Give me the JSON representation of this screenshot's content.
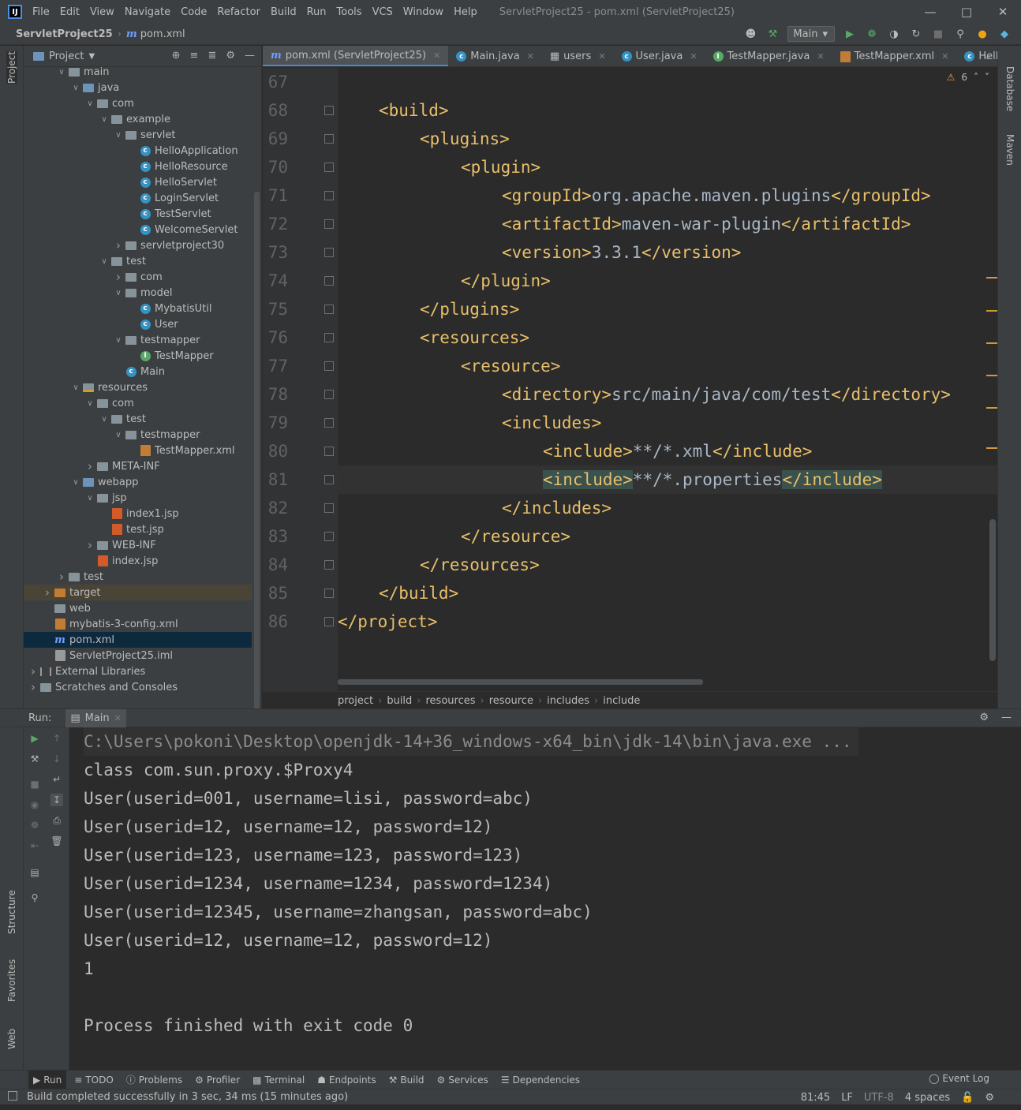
{
  "window": {
    "title": "ServletProject25 - pom.xml (ServletProject25)",
    "menu": [
      "File",
      "Edit",
      "View",
      "Navigate",
      "Code",
      "Refactor",
      "Build",
      "Run",
      "Tools",
      "VCS",
      "Window",
      "Help"
    ]
  },
  "navbar": {
    "project": "ServletProject25",
    "file": "pom.xml",
    "run_config": "Main"
  },
  "project_panel": {
    "title": "Project",
    "tree": [
      {
        "depth": 2,
        "arrow": "down",
        "icon": "folder",
        "label": "main"
      },
      {
        "depth": 3,
        "arrow": "down",
        "icon": "folder-blue",
        "label": "java"
      },
      {
        "depth": 4,
        "arrow": "down",
        "icon": "folder",
        "label": "com"
      },
      {
        "depth": 5,
        "arrow": "down",
        "icon": "folder",
        "label": "example"
      },
      {
        "depth": 6,
        "arrow": "down",
        "icon": "folder",
        "label": "servlet"
      },
      {
        "depth": 7,
        "arrow": "",
        "icon": "class",
        "label": "HelloApplication"
      },
      {
        "depth": 7,
        "arrow": "",
        "icon": "class",
        "label": "HelloResource"
      },
      {
        "depth": 7,
        "arrow": "",
        "icon": "class",
        "label": "HelloServlet"
      },
      {
        "depth": 7,
        "arrow": "",
        "icon": "class",
        "label": "LoginServlet"
      },
      {
        "depth": 7,
        "arrow": "",
        "icon": "class",
        "label": "TestServlet"
      },
      {
        "depth": 7,
        "arrow": "",
        "icon": "class",
        "label": "WelcomeServlet"
      },
      {
        "depth": 6,
        "arrow": "right",
        "icon": "folder",
        "label": "servletproject30"
      },
      {
        "depth": 5,
        "arrow": "down",
        "icon": "folder",
        "label": "test"
      },
      {
        "depth": 6,
        "arrow": "right",
        "icon": "folder",
        "label": "com"
      },
      {
        "depth": 6,
        "arrow": "down",
        "icon": "folder",
        "label": "model"
      },
      {
        "depth": 7,
        "arrow": "",
        "icon": "class",
        "label": "MybatisUtil"
      },
      {
        "depth": 7,
        "arrow": "",
        "icon": "class",
        "label": "User"
      },
      {
        "depth": 6,
        "arrow": "down",
        "icon": "folder",
        "label": "testmapper"
      },
      {
        "depth": 7,
        "arrow": "",
        "icon": "interface",
        "label": "TestMapper"
      },
      {
        "depth": 6,
        "arrow": "",
        "icon": "class",
        "label": "Main"
      },
      {
        "depth": 3,
        "arrow": "down",
        "icon": "folder-res",
        "label": "resources"
      },
      {
        "depth": 4,
        "arrow": "down",
        "icon": "folder",
        "label": "com"
      },
      {
        "depth": 5,
        "arrow": "down",
        "icon": "folder",
        "label": "test"
      },
      {
        "depth": 6,
        "arrow": "down",
        "icon": "folder",
        "label": "testmapper"
      },
      {
        "depth": 7,
        "arrow": "",
        "icon": "xml",
        "label": "TestMapper.xml"
      },
      {
        "depth": 4,
        "arrow": "right",
        "icon": "folder",
        "label": "META-INF"
      },
      {
        "depth": 3,
        "arrow": "down",
        "icon": "folder-blue",
        "label": "webapp"
      },
      {
        "depth": 4,
        "arrow": "down",
        "icon": "folder",
        "label": "jsp"
      },
      {
        "depth": 5,
        "arrow": "",
        "icon": "jsp",
        "label": "index1.jsp"
      },
      {
        "depth": 5,
        "arrow": "",
        "icon": "jsp",
        "label": "test.jsp"
      },
      {
        "depth": 4,
        "arrow": "right",
        "icon": "folder",
        "label": "WEB-INF"
      },
      {
        "depth": 4,
        "arrow": "",
        "icon": "jsp",
        "label": "index.jsp"
      },
      {
        "depth": 2,
        "arrow": "right",
        "icon": "folder",
        "label": "test"
      },
      {
        "depth": 1,
        "arrow": "right",
        "icon": "folder-orange",
        "label": "target",
        "state": "highlight"
      },
      {
        "depth": 1,
        "arrow": "",
        "icon": "folder",
        "label": "web"
      },
      {
        "depth": 1,
        "arrow": "",
        "icon": "xml",
        "label": "mybatis-3-config.xml"
      },
      {
        "depth": 1,
        "arrow": "",
        "icon": "maven",
        "label": "pom.xml",
        "state": "selected"
      },
      {
        "depth": 1,
        "arrow": "",
        "icon": "file",
        "label": "ServletProject25.iml"
      },
      {
        "depth": 0,
        "arrow": "right",
        "icon": "library",
        "label": "External Libraries"
      },
      {
        "depth": 0,
        "arrow": "right",
        "icon": "scratch",
        "label": "Scratches and Consoles"
      }
    ]
  },
  "editor": {
    "tabs": [
      {
        "label": "pom.xml (ServletProject25)",
        "icon": "maven",
        "active": true
      },
      {
        "label": "Main.java",
        "icon": "class"
      },
      {
        "label": "users",
        "icon": "table"
      },
      {
        "label": "User.java",
        "icon": "class"
      },
      {
        "label": "TestMapper.java",
        "icon": "interface"
      },
      {
        "label": "TestMapper.xml",
        "icon": "xml"
      },
      {
        "label": "HelloServlet.ja",
        "icon": "class"
      }
    ],
    "warning_count": "6",
    "lines": [
      {
        "n": "67",
        "indent": 0,
        "parts": []
      },
      {
        "n": "68",
        "indent": 1,
        "parts": [
          [
            "tag",
            "<build>"
          ]
        ]
      },
      {
        "n": "69",
        "indent": 2,
        "parts": [
          [
            "tag",
            "<plugins>"
          ]
        ]
      },
      {
        "n": "70",
        "indent": 3,
        "parts": [
          [
            "tag",
            "<plugin>"
          ]
        ]
      },
      {
        "n": "71",
        "indent": 4,
        "parts": [
          [
            "tag",
            "<groupId>"
          ],
          [
            "txt",
            "org.apache.maven.plugins"
          ],
          [
            "tag",
            "</groupId>"
          ]
        ]
      },
      {
        "n": "72",
        "indent": 4,
        "parts": [
          [
            "tag",
            "<artifactId>"
          ],
          [
            "txt",
            "maven-war-plugin"
          ],
          [
            "tag",
            "</artifactId>"
          ]
        ]
      },
      {
        "n": "73",
        "indent": 4,
        "parts": [
          [
            "tag",
            "<version>"
          ],
          [
            "txt",
            "3.3.1"
          ],
          [
            "tag",
            "</version>"
          ]
        ]
      },
      {
        "n": "74",
        "indent": 3,
        "parts": [
          [
            "tag",
            "</plugin>"
          ]
        ]
      },
      {
        "n": "75",
        "indent": 2,
        "parts": [
          [
            "tag",
            "</plugins>"
          ]
        ]
      },
      {
        "n": "76",
        "indent": 2,
        "parts": [
          [
            "tag",
            "<resources>"
          ]
        ]
      },
      {
        "n": "77",
        "indent": 3,
        "parts": [
          [
            "tag",
            "<resource>"
          ]
        ]
      },
      {
        "n": "78",
        "indent": 4,
        "parts": [
          [
            "tag",
            "<directory>"
          ],
          [
            "txt",
            "src/main/java/com/test"
          ],
          [
            "tag",
            "</directory>"
          ]
        ]
      },
      {
        "n": "79",
        "indent": 4,
        "parts": [
          [
            "tag",
            "<includes>"
          ]
        ]
      },
      {
        "n": "80",
        "indent": 5,
        "parts": [
          [
            "tag",
            "<include>"
          ],
          [
            "txt",
            "**/*.xml"
          ],
          [
            "tag",
            "</include>"
          ]
        ]
      },
      {
        "n": "81",
        "indent": 5,
        "parts": [
          [
            "tagm",
            "<include>"
          ],
          [
            "txt",
            "**/*.properties"
          ],
          [
            "tagm",
            "</include>"
          ]
        ],
        "current": true
      },
      {
        "n": "82",
        "indent": 4,
        "parts": [
          [
            "tag",
            "</includes>"
          ]
        ]
      },
      {
        "n": "83",
        "indent": 3,
        "parts": [
          [
            "tag",
            "</resource>"
          ]
        ]
      },
      {
        "n": "84",
        "indent": 2,
        "parts": [
          [
            "tag",
            "</resources>"
          ]
        ]
      },
      {
        "n": "85",
        "indent": 1,
        "parts": [
          [
            "tag",
            "</build>"
          ]
        ]
      },
      {
        "n": "86",
        "indent": 0,
        "parts": [
          [
            "tag",
            "</project>"
          ]
        ]
      }
    ],
    "breadcrumbs": [
      "project",
      "build",
      "resources",
      "resource",
      "includes",
      "include"
    ]
  },
  "run": {
    "label": "Run:",
    "tab": "Main",
    "output": [
      "C:\\Users\\pokoni\\Desktop\\openjdk-14+36_windows-x64_bin\\jdk-14\\bin\\java.exe ...",
      "class com.sun.proxy.$Proxy4",
      "User(userid=001, username=lisi, password=abc)",
      "User(userid=12, username=12, password=12)",
      "User(userid=123, username=123, password=123)",
      "User(userid=1234, username=1234, password=1234)",
      "User(userid=12345, username=zhangsan, password=abc)",
      "User(userid=12, username=12, password=12)",
      "1",
      "",
      "Process finished with exit code 0"
    ]
  },
  "side_labels": {
    "left": [
      "Project",
      "Structure",
      "Favorites",
      "Web"
    ],
    "right": [
      "Database",
      "Maven"
    ]
  },
  "tool_windows": [
    "Run",
    "TODO",
    "Problems",
    "Profiler",
    "Terminal",
    "Endpoints",
    "Build",
    "Services",
    "Dependencies"
  ],
  "event_log": "Event Log",
  "status": {
    "message": "Build completed successfully in 3 sec, 34 ms (15 minutes ago)",
    "position": "81:45",
    "line_sep": "LF",
    "encoding": "UTF-8",
    "indent": "4 spaces"
  }
}
